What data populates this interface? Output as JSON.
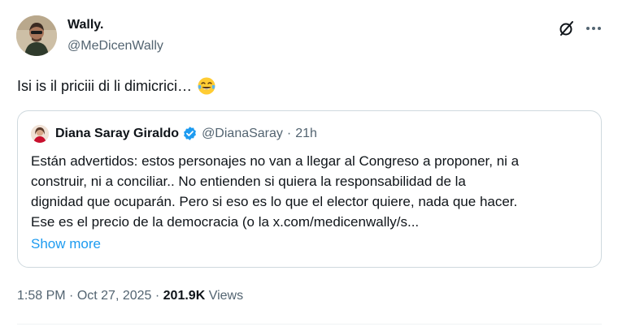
{
  "author": {
    "name": "Wally.",
    "handle": "@MeDicenWally"
  },
  "tweet": {
    "text": "Isi is il priciii di li dimicrici…",
    "emoji": "face-with-tears-of-joy"
  },
  "quote": {
    "name": "Diana Saray Giraldo",
    "handle": "@DianaSaray",
    "separator": "·",
    "time": "21h",
    "lines": [
      "Están advertidos: estos personajes no van a llegar al Congreso a proponer, ni a",
      "construir, ni a conciliar.. No entienden si quiera la responsabilidad de la",
      "dignidad que ocuparán. Pero si eso es lo que el elector quiere, nada que hacer.",
      "Ese es el precio de la democracia (o la x.com/medicenwally/s..."
    ],
    "show_more": "Show more"
  },
  "meta": {
    "time": "1:58 PM",
    "sep": " · ",
    "date": "Oct 27, 2025",
    "sep2": " · ",
    "views_count": "201.9K",
    "views_label": " Views"
  },
  "colors": {
    "text": "#0f1419",
    "secondary": "#536471",
    "link": "#1d9bf0",
    "verified": "#1d9bf0",
    "border": "#cfd9de"
  },
  "icons": [
    "grok-icon",
    "more-icon",
    "verified-badge-icon"
  ]
}
